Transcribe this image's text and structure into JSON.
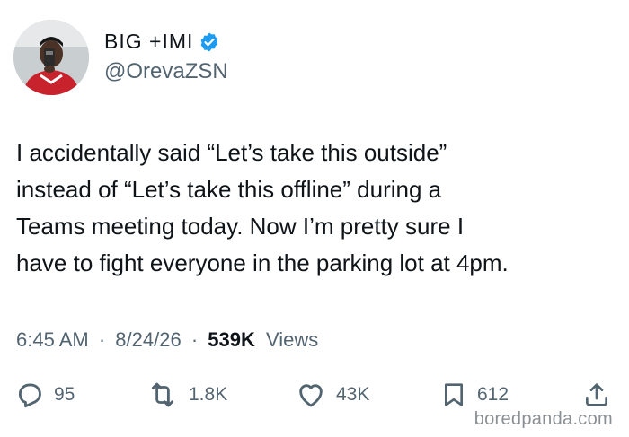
{
  "author": {
    "display_name": "BIG +IMI",
    "handle": "@OrevaZSN",
    "verified": true
  },
  "tweet": {
    "lines": [
      "I accidentally said “Let’s take this outside”",
      "instead of “Let’s take this offline” during a",
      "Teams meeting today. Now I’m pretty sure I",
      "have to fight everyone in the parking lot at 4pm."
    ]
  },
  "meta": {
    "time": "6:45 AM",
    "separator": "·",
    "date": "8/24/26",
    "views_count": "539K",
    "views_label": "Views"
  },
  "actions": {
    "replies": "95",
    "reposts": "1.8K",
    "likes": "43K",
    "bookmarks": "612"
  },
  "watermark": "boredpanda.com",
  "colors": {
    "verified_badge": "#1d9bf0",
    "text_primary": "#0f1419",
    "text_secondary": "#536471"
  }
}
